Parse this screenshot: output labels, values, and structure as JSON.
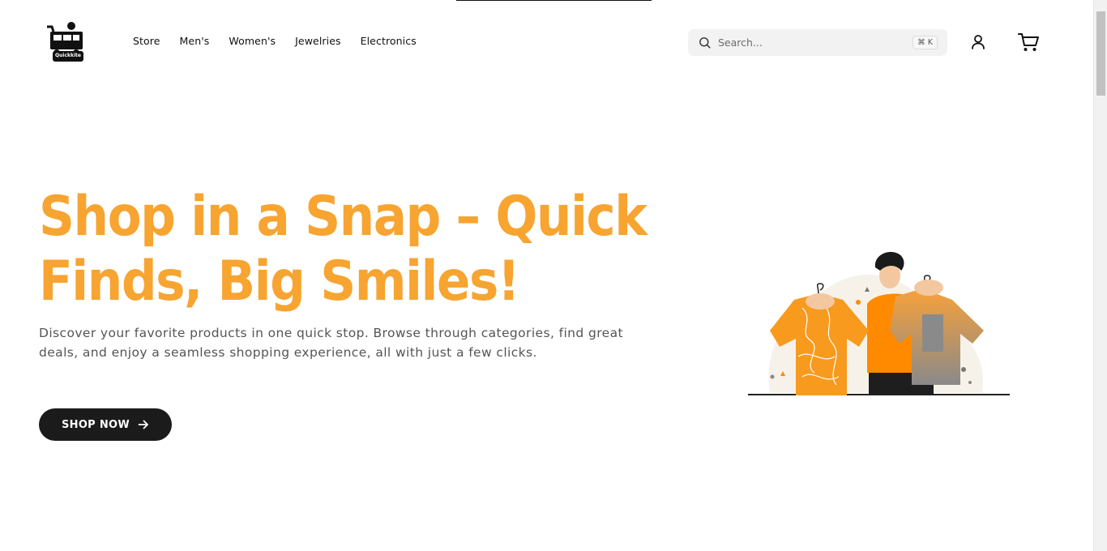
{
  "logo": {
    "text": "Quickkite"
  },
  "nav": {
    "items": [
      {
        "label": "Store"
      },
      {
        "label": "Men's"
      },
      {
        "label": "Women's"
      },
      {
        "label": "Jewelries"
      },
      {
        "label": "Electronics"
      }
    ]
  },
  "search": {
    "placeholder": "Search...",
    "shortcut": "⌘ K"
  },
  "icons": {
    "search": "search-icon",
    "user": "user-icon",
    "cart": "cart-icon",
    "arrow": "arrow-right-icon"
  },
  "hero": {
    "title": "Shop in a Snap – Quick Finds, Big Smiles!",
    "subtitle": "Discover your favorite products in one quick stop. Browse through categories, find great deals, and enjoy a seamless shopping experience, all with just a few clicks.",
    "cta_label": "SHOP NOW"
  },
  "colors": {
    "accent": "#f7a431",
    "button_bg": "#1b1b1b",
    "orange_shirt": "#ff8a00"
  }
}
